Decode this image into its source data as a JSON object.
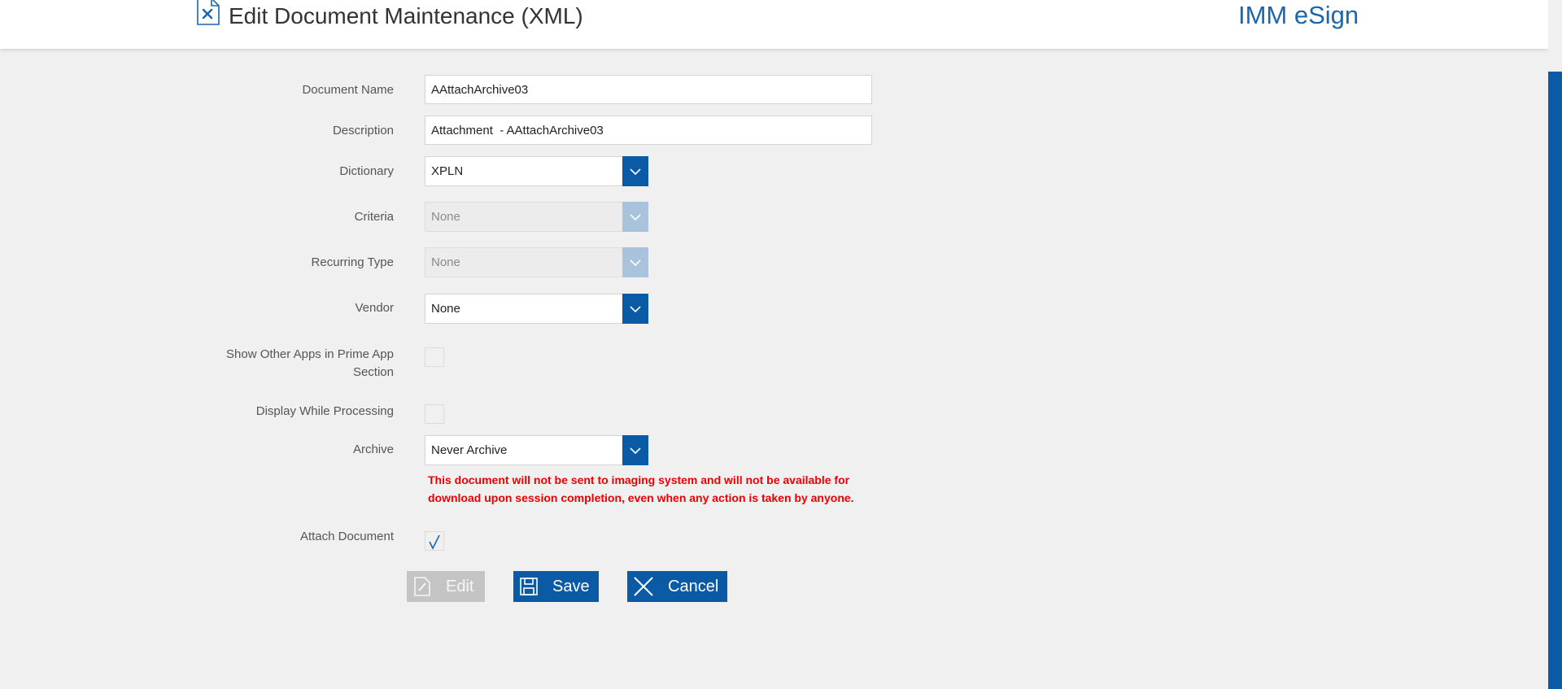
{
  "header": {
    "title": "Edit Document Maintenance (XML)",
    "brand": "IMM eSign",
    "icon": "document-settings-icon"
  },
  "form": {
    "document_name": {
      "label": "Document Name",
      "value": "AAttachArchive03"
    },
    "description": {
      "label": "Description",
      "value": "Attachment  - AAttachArchive03"
    },
    "dictionary": {
      "label": "Dictionary",
      "value": "XPLN"
    },
    "criteria": {
      "label": "Criteria",
      "value": "None",
      "disabled": true
    },
    "recurring_type": {
      "label": "Recurring Type",
      "value": "None",
      "disabled": true
    },
    "vendor": {
      "label": "Vendor",
      "value": "None"
    },
    "show_other_apps": {
      "label": "Show Other Apps in Prime App Section",
      "checked": false
    },
    "display_while_processing": {
      "label": "Display While Processing",
      "checked": false
    },
    "archive": {
      "label": "Archive",
      "value": "Never Archive",
      "warning": "This document will not be sent to imaging system and will not be available for download upon session completion, even when any action is taken by anyone."
    },
    "attach_document": {
      "label": "Attach Document",
      "checked": true
    }
  },
  "buttons": {
    "edit": {
      "label": "Edit",
      "icon": "pencil-icon",
      "disabled": true
    },
    "save": {
      "label": "Save",
      "icon": "floppy-disk-icon"
    },
    "cancel": {
      "label": "Cancel",
      "icon": "close-icon"
    }
  },
  "colors": {
    "accent": "#0a5aa6",
    "brand": "#1b66ad",
    "warning": "#ee0000",
    "background": "#f0f0f0"
  }
}
